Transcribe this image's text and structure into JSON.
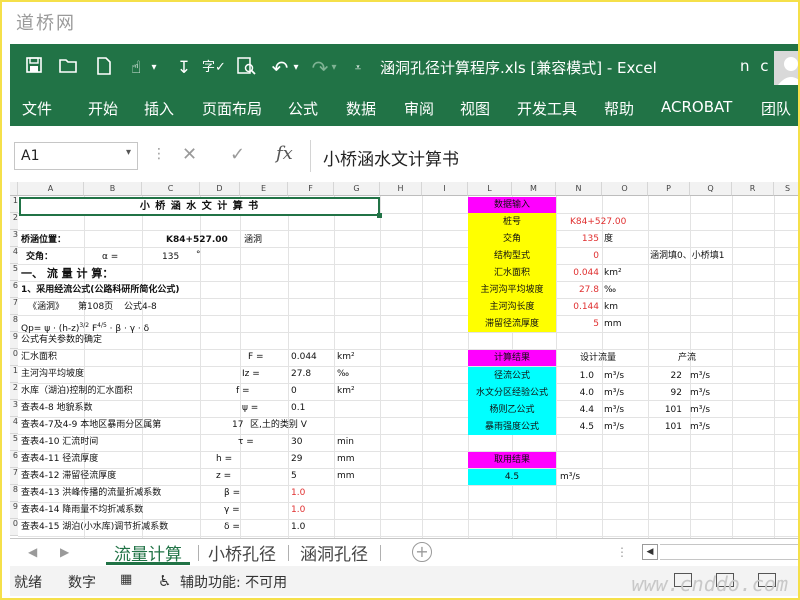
{
  "watermark": {
    "top": "道桥网",
    "bottom": "www.cnddo.com"
  },
  "quick_access": {
    "icons": [
      "save-icon",
      "open-icon",
      "new-icon",
      "touch-mode-icon",
      "sort-icon",
      "spell-check-icon",
      "print-preview-icon",
      "undo-icon",
      "redo-icon",
      "customize-icon"
    ]
  },
  "window": {
    "title": "涵洞孔径计算程序.xls  [兼容模式]  -  Excel",
    "user": "n c"
  },
  "ribbon": {
    "tabs": [
      "文件",
      "开始",
      "插入",
      "页面布局",
      "公式",
      "数据",
      "审阅",
      "视图",
      "开发工具",
      "帮助",
      "ACROBAT",
      "团队"
    ]
  },
  "formula_bar": {
    "name_box": "A1",
    "fx": "fx",
    "content": "小桥涵水文计算书"
  },
  "sheet": {
    "columns": [
      "A",
      "B",
      "C",
      "D",
      "E",
      "F",
      "G",
      "H",
      "I",
      "L",
      "M",
      "N",
      "O",
      "P",
      "Q",
      "R",
      "S"
    ],
    "rows": [
      "1",
      "2",
      "3",
      "4",
      "5",
      "6",
      "7",
      "8",
      "9",
      "0",
      "1",
      "2",
      "3",
      "4",
      "5",
      "6",
      "7",
      "8",
      "9",
      "0"
    ],
    "left": {
      "title": "小 桥 涵 水 文 计 算 书",
      "location_label": "桥涵位置：",
      "location_value": "K84+527.00",
      "location_type": "涵洞",
      "angle_label": "交角：",
      "alpha_label": "α =",
      "angle_value": "135",
      "angle_unit": "°",
      "section1": "一、 流 量 计 算：",
      "method": "1、采用经流公式(公路科研所简化公式)",
      "ref_book": "《涵洞》",
      "ref_page": "第108页",
      "ref_formula": "公式4-8",
      "formula": "Qp= ψ · (h-z)",
      "formula_exp1": "3/2",
      "formula_mid": " F",
      "formula_exp2": "4/5",
      "formula_tail": " · β · γ · δ",
      "params_header": "公式有关参数的确定",
      "rows": [
        {
          "label": "汇水面积",
          "sym": "F =",
          "value": "0.044",
          "unit": "km²"
        },
        {
          "label": "主河沟平均坡度",
          "sym": "Iz =",
          "value": "27.8",
          "unit": "‰"
        },
        {
          "label": "水库（湖泊)控制的汇水面积",
          "sym": "f =",
          "value": "0",
          "unit": "km²"
        },
        {
          "label": "查表4-8       地貌系数",
          "sym": "ψ =",
          "value": "0.1",
          "unit": ""
        },
        {
          "label": "     查表4-7及4-9 本地区暴雨分区属第",
          "sym": "17",
          "value": "区,土的类别 V",
          "unit": ""
        },
        {
          "label": "查表4-10      汇流时间",
          "sym": "τ =",
          "value": "30",
          "unit": "min"
        },
        {
          "label": "查表4-11      径流厚度",
          "sym": "h =",
          "value": "29",
          "unit": "mm"
        },
        {
          "label": "查表4-12      滞留径流厚度",
          "sym": "z =",
          "value": "5",
          "unit": "mm"
        },
        {
          "label": "查表4-13    洪峰传播的流量折减系数",
          "sym": "β =",
          "value": "1.0",
          "unit": ""
        },
        {
          "label": "查表4-14    降雨量不均折减系数",
          "sym": "γ =",
          "value": "1.0",
          "unit": ""
        },
        {
          "label": "查表4-15    湖泊(小水库)调节折减系数",
          "sym": "δ =",
          "value": "1.0",
          "unit": ""
        }
      ]
    },
    "right": {
      "input_header": "数据输入",
      "inputs": [
        {
          "label": "桩号",
          "value": "K84+527.00",
          "unit": ""
        },
        {
          "label": "交角",
          "value": "135",
          "unit": "度"
        },
        {
          "label": "结构型式",
          "value": "0",
          "unit": "",
          "note": "涵洞填0、小桥填1"
        },
        {
          "label": "汇水面积",
          "value": "0.044",
          "unit": "km²"
        },
        {
          "label": "主河沟平均坡度",
          "value": "27.8",
          "unit": "‰"
        },
        {
          "label": "主河沟长度",
          "value": "0.144",
          "unit": "km"
        },
        {
          "label": "滞留径流厚度",
          "value": "5",
          "unit": "mm"
        }
      ],
      "results_header": "计算结果",
      "design_flow_header": "设计流量",
      "yield_header": "产流",
      "results": [
        {
          "label": "径流公式",
          "value": "1.0",
          "unit": "m³/s",
          "yield": "22",
          "yield_unit": "m³/s"
        },
        {
          "label": "水文分区经验公式",
          "value": "4.0",
          "unit": "m³/s",
          "yield": "92",
          "yield_unit": "m³/s"
        },
        {
          "label": "杨则乙公式",
          "value": "4.4",
          "unit": "m³/s",
          "yield": "101",
          "yield_unit": "m³/s"
        },
        {
          "label": "暴雨强度公式",
          "value": "4.5",
          "unit": "m³/s",
          "yield": "101",
          "yield_unit": "m³/s"
        }
      ],
      "pick_header": "取用结果",
      "pick_value": "4.5",
      "pick_unit": "m³/s"
    }
  },
  "sheet_tabs": [
    "流量计算",
    "小桥孔径",
    "涵洞孔径"
  ],
  "sheet_tabs_extra": {
    "add": "+",
    "dots": "⋮"
  },
  "status": {
    "ready": "就绪",
    "mode": "数字",
    "accessibility": "辅助功能: 不可用"
  },
  "colors": {
    "excel_green": "#217346",
    "magenta": "#ff00ff",
    "yellow": "#ffff00",
    "cyan": "#00ffff",
    "red_value": "#e03030"
  }
}
